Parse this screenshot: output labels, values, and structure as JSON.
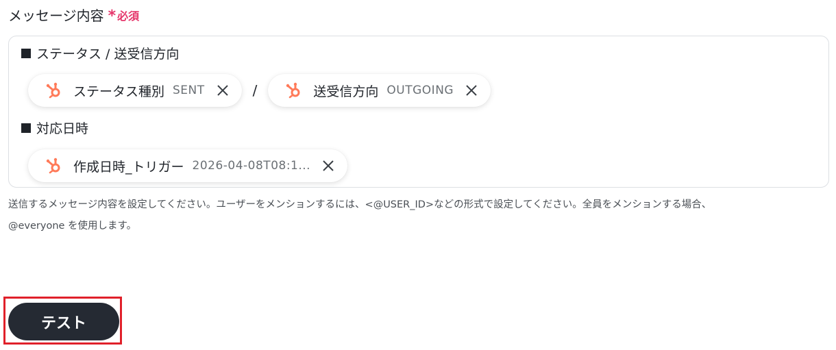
{
  "field": {
    "label": "メッセージ内容",
    "required_mark": "*",
    "required_text": "必須"
  },
  "editor": {
    "sections": [
      {
        "heading": "ステータス / 送受信方向",
        "chips": [
          {
            "name": "ステータス種別",
            "value": "SENT",
            "icon": "hubspot-icon"
          },
          {
            "name": "送受信方向",
            "value": "OUTGOING",
            "icon": "hubspot-icon"
          }
        ],
        "separator": "/"
      },
      {
        "heading": "対応日時",
        "chips": [
          {
            "name": "作成日時_トリガー",
            "value": "2026-04-08T08:1...",
            "icon": "hubspot-icon"
          }
        ]
      }
    ]
  },
  "help": {
    "line1": "送信するメッセージ内容を設定してください。ユーザーをメンションするには、<@USER_ID>などの形式で設定してください。全員をメンションする場合、",
    "line2": "@everyone を使用します。"
  },
  "actions": {
    "test_label": "テスト"
  },
  "colors": {
    "required": "#e5366b",
    "hubspot": "#ff7a59",
    "button_bg": "#252a33",
    "highlight": "#e0202a"
  }
}
